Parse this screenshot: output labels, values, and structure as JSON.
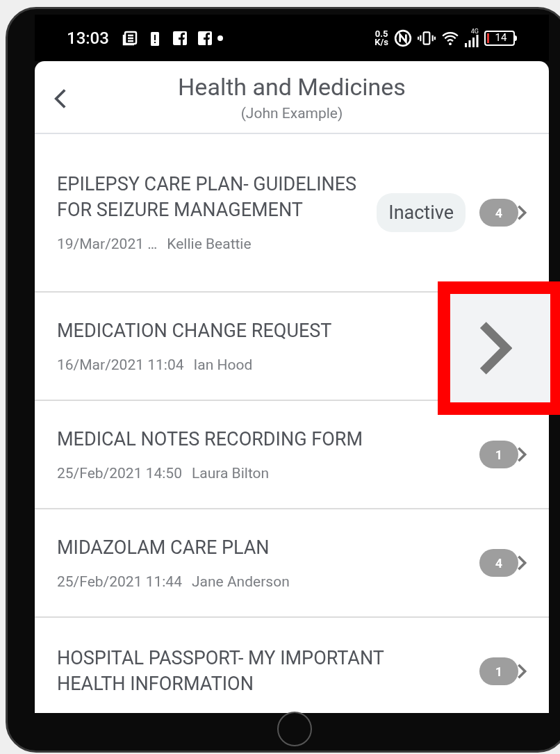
{
  "status_bar": {
    "time": "13:03",
    "speed_value": "0.5",
    "speed_unit": "K/s",
    "network": "4G",
    "battery": "14"
  },
  "header": {
    "title": "Health and Medicines",
    "subtitle": "(John Example)"
  },
  "rows": [
    {
      "title": "EPILEPSY CARE PLAN- GUIDELINES FOR SEIZURE MANAGEMENT",
      "date": "19/Mar/2021 …",
      "author": "Kellie Beattie",
      "status": "Inactive",
      "count": "4"
    },
    {
      "title": "MEDICATION CHANGE REQUEST",
      "date": "16/Mar/2021 11:04",
      "author": "Ian Hood"
    },
    {
      "title": "MEDICAL NOTES RECORDING FORM",
      "date": "25/Feb/2021 14:50",
      "author": "Laura Bilton",
      "count": "1"
    },
    {
      "title": "MIDAZOLAM CARE PLAN",
      "date": "25/Feb/2021 11:44",
      "author": "Jane Anderson",
      "count": "4"
    },
    {
      "title": "HOSPITAL PASSPORT- MY IMPORTANT HEALTH INFORMATION",
      "count": "1"
    }
  ]
}
